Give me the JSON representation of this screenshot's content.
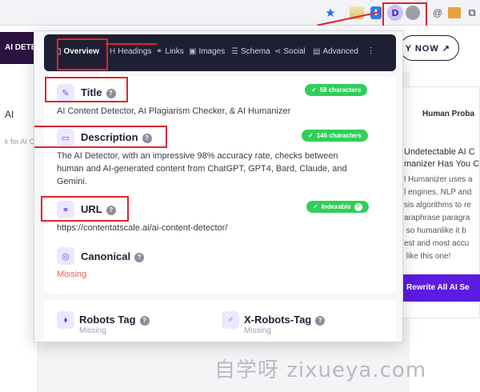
{
  "browser": {
    "extension_letter": "D",
    "extension_icons": [
      "star-icon",
      "notes-extension-icon",
      "download-extension-icon",
      "seo-extension-icon",
      "grey-extension-icon",
      "at-icon",
      "shop-extension-icon",
      "puzzle-icon"
    ]
  },
  "background_page": {
    "logo_text": "AI DETE",
    "cta_label": "Y NOW ↗",
    "left_heading": "AI",
    "left_caption": "k for AI C",
    "right_title": "Human Proba",
    "right_subtitle": "Undetectable AI C\nmanizer Has You C",
    "right_paragraph": "l Humanizer uses a\nl engines, NLP and\nsis algorithms to re\naraphrase paragra\n so humanlike it b\nest and most accu\n like this one!",
    "right_button": "Rewrite All AI Se"
  },
  "popup": {
    "nav": [
      {
        "label": "Overview",
        "icon": "▯"
      },
      {
        "label": "Headings",
        "icon": "H"
      },
      {
        "label": "Links",
        "icon": "⚭"
      },
      {
        "label": "Images",
        "icon": "▣"
      },
      {
        "label": "Schema",
        "icon": "☰"
      },
      {
        "label": "Social",
        "icon": "⋖"
      },
      {
        "label": "Advanced",
        "icon": "▤"
      }
    ],
    "title": {
      "label": "Title",
      "badge": "58 characters",
      "value": "AI Content Detector, AI Plagiarism Checker, & AI Humanizer"
    },
    "description": {
      "label": "Description",
      "badge": "146 characters",
      "value": "The AI Detector, with an impressive 98% accuracy rate, checks between human and AI-generated content from ChatGPT, GPT4, Bard, Claude, and Gemini."
    },
    "url": {
      "label": "URL",
      "badge": "Indexable",
      "value": "https://contentatscale.ai/ai-content-detector/"
    },
    "canonical": {
      "label": "Canonical",
      "value": "Missing"
    },
    "robots": {
      "label": "Robots Tag",
      "value": "Missing"
    },
    "x_robots": {
      "label": "X-Robots-Tag",
      "value": "Missing"
    }
  },
  "watermark": "自学呀 zixueya.com",
  "colors": {
    "accent": "#6b4fe0",
    "nav_bg": "#1f1f33",
    "badge_green": "#2fcf5a",
    "highlight_red": "#e0242f",
    "missing_red": "#e36060"
  }
}
